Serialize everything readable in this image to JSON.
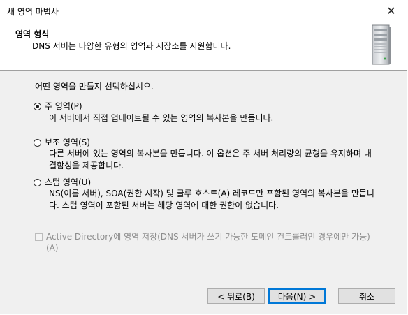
{
  "window": {
    "title": "새 영역 마법사"
  },
  "header": {
    "title": "영역 형식",
    "description": "DNS 서버는 다양한 유형의 영역과 저장소를 지원합니다."
  },
  "body": {
    "question": "어떤 영역을 만들지 선택하십시오.",
    "options": [
      {
        "label": "주 영역(P)",
        "description": "이 서버에서 직접 업데이트될 수 있는 영역의 복사본을 만듭니다.",
        "checked": true
      },
      {
        "label": "보조 영역(S)",
        "description": "다른 서버에 있는 영역의 복사본을 만듭니다. 이 옵션은 주 서버 처리량의 균형을 유지하며 내결함성을 제공합니다.",
        "checked": false
      },
      {
        "label": "스텁 영역(U)",
        "description": "NS(이름 서버), SOA(권한 시작) 및 글루 호스트(A) 레코드만 포함된 영역의 복사본을 만듭니다. 스텁 영역이 포함된 서버는 해당 영역에 대한 권한이 없습니다.",
        "checked": false
      }
    ],
    "ad_checkbox": {
      "label": "Active Directory에 영역 저장(DNS 서버가 쓰기 가능한 도메인 컨트롤러인 경우에만 가능)(A)",
      "checked": false,
      "enabled": false
    }
  },
  "buttons": {
    "back": "< 뒤로(B)",
    "next": "다음(N) >",
    "cancel": "취소"
  }
}
